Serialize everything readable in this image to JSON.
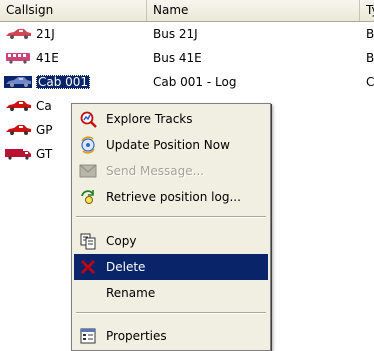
{
  "list": {
    "columns": [
      "Callsign",
      "Name",
      "Ty"
    ],
    "rows": [
      {
        "callsign": "21J",
        "name": "Bus 21J",
        "type": "Bus",
        "icon": "car-icon",
        "color": "#cc3344"
      },
      {
        "callsign": "41E",
        "name": "Bus 41E",
        "type": "Bus",
        "icon": "bus-icon",
        "color": "#cc3366"
      },
      {
        "callsign": "Cab 001",
        "name": "Cab 001 - Log",
        "type": "Ca",
        "icon": "car-icon",
        "color": "#3355aa"
      },
      {
        "callsign": "Ca",
        "name": "",
        "type": "",
        "icon": "car-icon",
        "color": "#cc1111"
      },
      {
        "callsign": "GP",
        "name": "",
        "type": "",
        "icon": "car-icon",
        "color": "#cc1111"
      },
      {
        "callsign": "GT",
        "name": "",
        "type": "",
        "icon": "truck-icon",
        "color": "#bb1133"
      }
    ],
    "selected_row": 2
  },
  "context_menu": {
    "items": [
      {
        "label": "Explore Tracks",
        "icon": "explore-tracks-icon"
      },
      {
        "label": "Update Position Now",
        "icon": "update-position-icon"
      },
      {
        "label": "Send Message...",
        "icon": "send-message-icon",
        "disabled": true
      },
      {
        "label": "Retrieve position log...",
        "icon": "retrieve-log-icon"
      },
      {
        "label": "Copy",
        "icon": "copy-icon"
      },
      {
        "label": "Delete",
        "icon": "delete-icon",
        "highlighted": true
      },
      {
        "label": "Rename",
        "icon": ""
      },
      {
        "label": "Properties",
        "icon": "properties-icon"
      }
    ]
  },
  "colors": {
    "selection": "#0a246a",
    "menu_bg": "#f1efe2",
    "delete_x": "#cc0000"
  }
}
